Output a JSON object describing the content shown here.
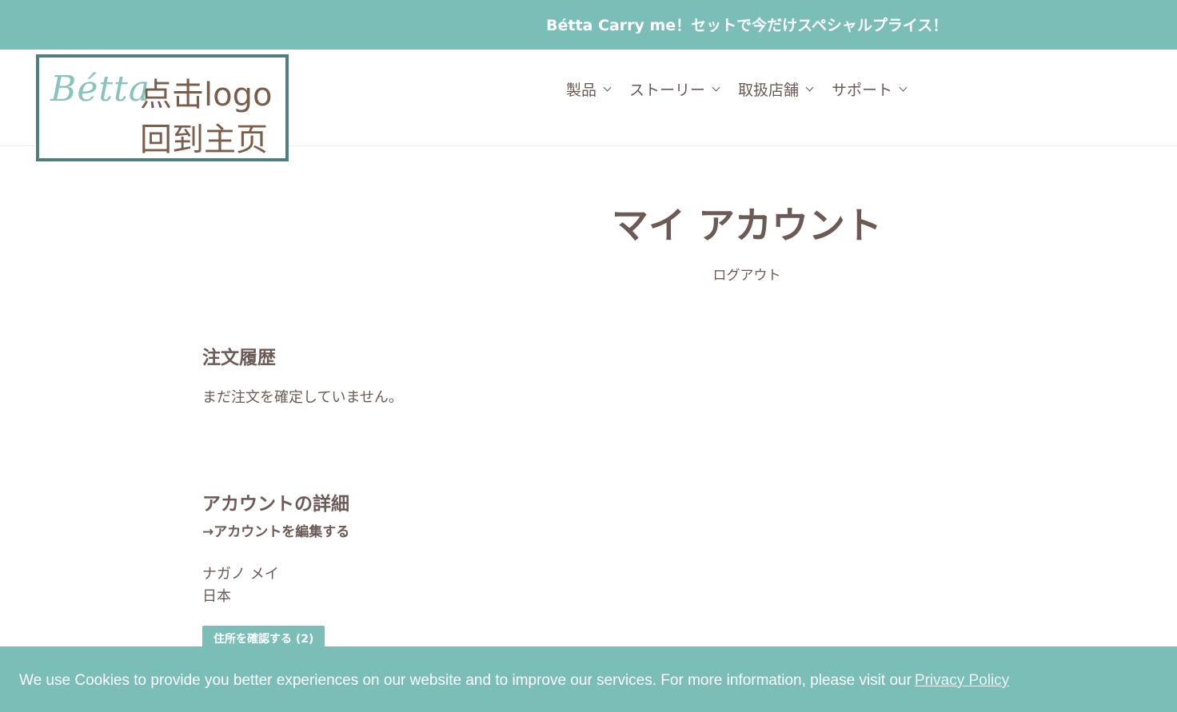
{
  "announcement": "Bétta Carry me！セットで今だけスペシャルプライス！",
  "logo": {
    "brand": "Bétta",
    "line1": "点击logo",
    "line2": "回到主页"
  },
  "nav": [
    {
      "label": "製品"
    },
    {
      "label": "ストーリー"
    },
    {
      "label": "取扱店舗"
    },
    {
      "label": "サポート"
    }
  ],
  "page": {
    "title": "マイ アカウント",
    "logout": "ログアウト"
  },
  "orders": {
    "title": "注文履歴",
    "empty": "まだ注文を確定していません。"
  },
  "account": {
    "title": "アカウントの詳細",
    "edit_link": "→アカウントを編集する",
    "name": "ナガノ メイ",
    "country": "日本",
    "address_button": "住所を確認する (2)"
  },
  "cookie": {
    "text": "We use Cookies to provide you better experiences on our website and to improve our services. For more information, please visit our",
    "link": "Privacy Policy"
  },
  "colors": {
    "accent": "#7bbdb7",
    "text": "#6b5a55",
    "logo_border": "#4f7f7d"
  }
}
